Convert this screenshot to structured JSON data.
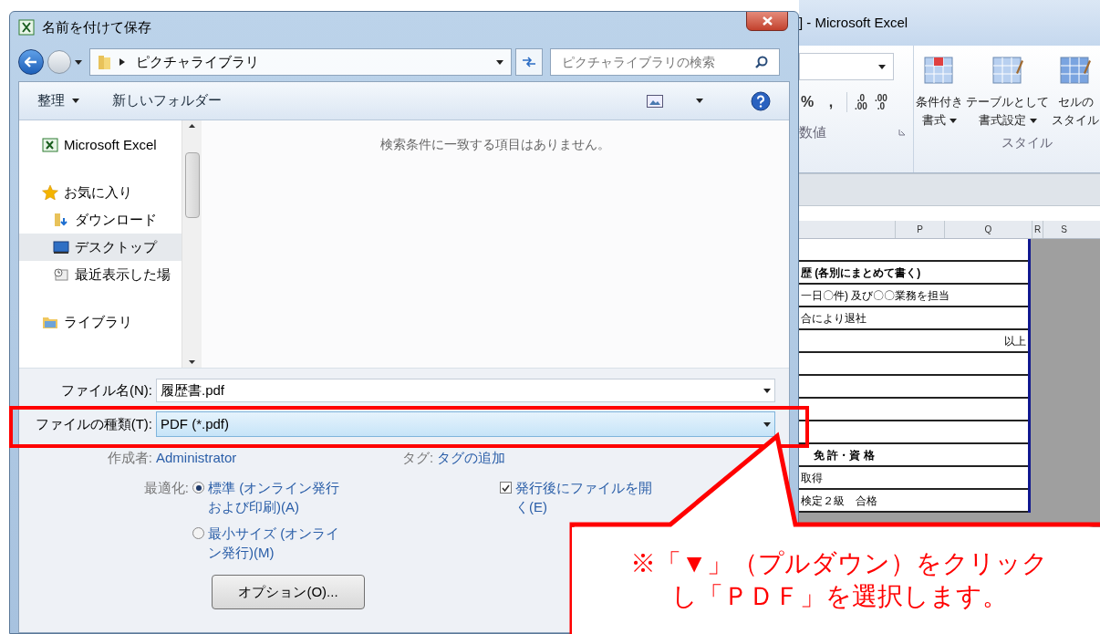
{
  "dialog": {
    "title": "名前を付けて保存",
    "address": "ピクチャライブラリ",
    "search_placeholder": "ピクチャライブラリの検索",
    "toolbar": [
      {
        "label": "整理",
        "kind": "menu"
      },
      {
        "label": "新しいフォルダー",
        "kind": "button"
      }
    ],
    "nav_items": [
      {
        "label": "Microsoft Excel",
        "kind": "app",
        "selected": false
      },
      {
        "label": "お気に入り",
        "kind": "favorites",
        "selected": false
      },
      {
        "label": "ダウンロード",
        "kind": "download",
        "selected": false
      },
      {
        "label": "デスクトップ",
        "kind": "desktop",
        "selected": true
      },
      {
        "label": "最近表示した場",
        "kind": "recent",
        "selected": false
      },
      {
        "label": "ライブラリ",
        "kind": "library",
        "selected": false
      }
    ],
    "empty_message": "検索条件に一致する項目はありません。",
    "file_name": {
      "label": "ファイル名(N):",
      "value": "履歴書.pdf"
    },
    "file_type": {
      "label": "ファイルの種類(T):",
      "value": "PDF (*.pdf)"
    },
    "author": {
      "label": "作成者:",
      "value": "Administrator"
    },
    "tags": {
      "label": "タグ:",
      "value": "タグの追加"
    },
    "optimize": {
      "label": "最適化:",
      "options": [
        {
          "label": "標準 (オンライン発行および印刷)(A)",
          "selected": true
        },
        {
          "label": "最小サイズ (オンライン発行)(M)",
          "selected": false
        }
      ]
    },
    "open_after": {
      "label": "発行後にファイルを開く(E)",
      "checked": true
    },
    "options_button": "オプション(O)..."
  },
  "excel": {
    "title": "] - Microsoft Excel",
    "number_symbols": [
      "%",
      ","
    ],
    "decimal_buttons": [
      {
        "top": ".0",
        "bottom": ".00"
      },
      {
        "top": ".00",
        "bottom": ".0"
      }
    ],
    "number_group": "数値",
    "styles": [
      {
        "lines": [
          "条件付き",
          "書式"
        ],
        "menu": true
      },
      {
        "lines": [
          "テーブルとして",
          "書式設定"
        ],
        "menu": true
      },
      {
        "lines": [
          "セルの",
          "スタイル"
        ],
        "menu": false
      }
    ],
    "styles_group": "スタイル",
    "columns": [
      "P",
      "Q",
      "R",
      "S"
    ],
    "rows": [
      {
        "text": "",
        "kind": "entry"
      },
      {
        "text": "歴 (各別にまとめて書く)",
        "kind": "heading"
      },
      {
        "text": "一日〇件) 及び〇〇業務を担当",
        "kind": "entry"
      },
      {
        "text": "合により退社",
        "kind": "entry"
      },
      {
        "text": "以上",
        "kind": "closing"
      },
      {
        "text": "",
        "kind": "entry"
      },
      {
        "text": "",
        "kind": "entry"
      },
      {
        "text": "",
        "kind": "entry"
      },
      {
        "text": "",
        "kind": "entry"
      },
      {
        "text": "免 許・資 格",
        "kind": "heading"
      },
      {
        "text": "取得",
        "kind": "entry"
      },
      {
        "text": "検定２級　合格",
        "kind": "entry"
      }
    ]
  },
  "callout": {
    "lines": [
      "※「▼」（プルダウン）をクリック",
      "し「ＰＤＦ」を選択します。"
    ]
  }
}
